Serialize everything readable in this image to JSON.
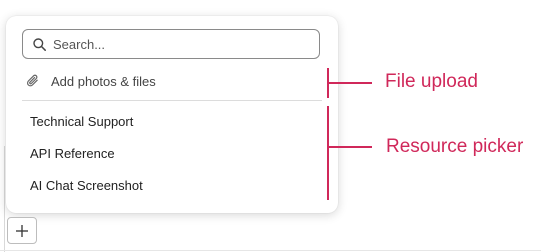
{
  "popover": {
    "search": {
      "placeholder": "Search...",
      "icon": "search-icon"
    },
    "upload": {
      "label": "Add photos & files",
      "icon": "paperclip-icon"
    },
    "resources": [
      {
        "label": "Technical Support"
      },
      {
        "label": "API Reference"
      },
      {
        "label": "AI Chat Screenshot"
      }
    ]
  },
  "composer": {
    "add_icon": "plus-icon"
  },
  "annotations": {
    "file_upload": "File upload",
    "resource_picker": "Resource picker",
    "color": "#d0285a"
  }
}
